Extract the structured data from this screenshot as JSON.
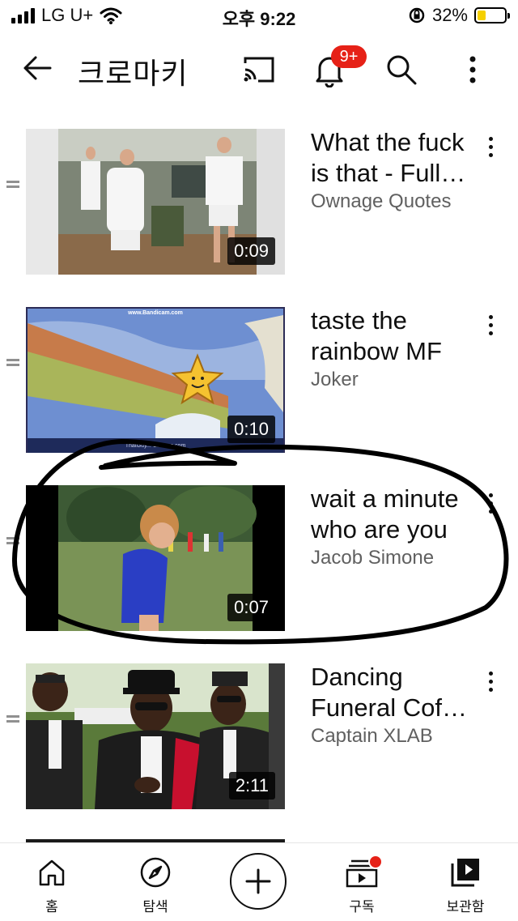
{
  "status_bar": {
    "carrier": "LG U+",
    "time": "오후 9:22",
    "battery": "32%",
    "battery_level": 0.32
  },
  "app_bar": {
    "title": "크로마키",
    "notification_count": "9+"
  },
  "videos": [
    {
      "title": "What the fuck is that - Full…",
      "channel": "Ownage Quotes",
      "duration": "0:09",
      "thumbnail": "barracks-scene"
    },
    {
      "title": "taste the rainbow MF",
      "channel": "Joker",
      "duration": "0:10",
      "thumbnail": "cartoon-star-rainbow",
      "watermark_top": "www.Bandicam.com",
      "watermark_bottom": "ThatGuy... Glasses.com"
    },
    {
      "title": "wait a minute who are you",
      "channel": "Jacob Simone",
      "duration": "0:07",
      "thumbnail": "boy-in-field"
    },
    {
      "title": "Dancing Funeral Cof…",
      "channel": "Captain XLAB",
      "duration": "2:11",
      "thumbnail": "pallbearers"
    }
  ],
  "bottom_nav": {
    "home": "홈",
    "explore": "탐색",
    "subscriptions": "구독",
    "library": "보관함"
  },
  "colors": {
    "accent_red": "#e62117",
    "text_primary": "#0f0f0f",
    "text_secondary": "#606060",
    "battery_fill": "#f5d000"
  }
}
